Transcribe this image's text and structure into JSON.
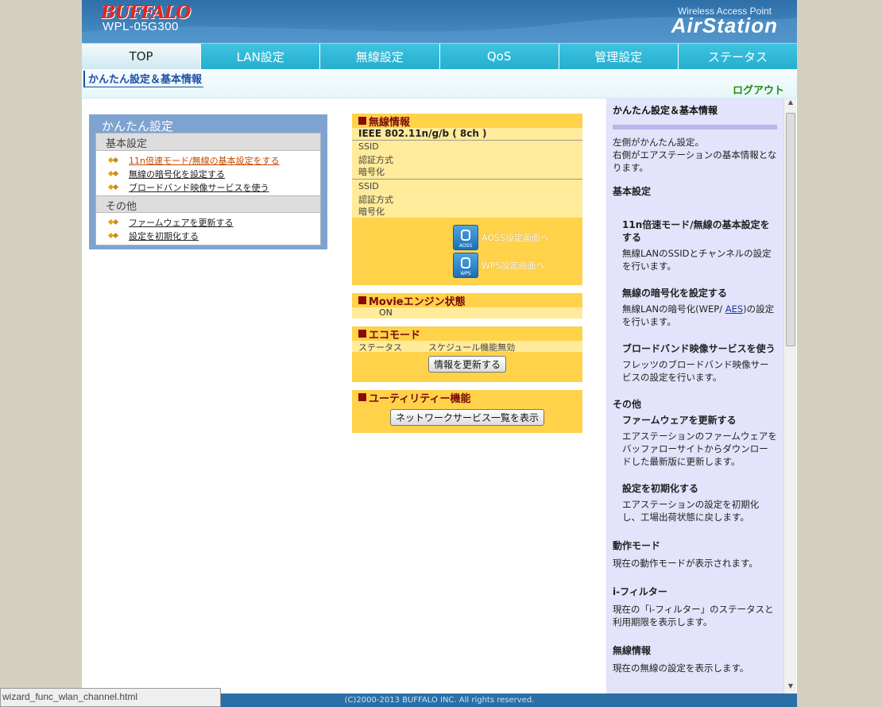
{
  "header": {
    "brand": "BUFFALO",
    "model": "WPL-05G300",
    "product_sub": "Wireless Access Point",
    "product": "AirStation"
  },
  "nav": {
    "tabs": [
      "TOP",
      "LAN設定",
      "無線設定",
      "QoS",
      "管理設定",
      "ステータス"
    ]
  },
  "subbar": {
    "breadcrumb": "かんたん設定＆基本情報",
    "logout": "ログアウト"
  },
  "easy": {
    "title": "かんたん設定",
    "section1": "基本設定",
    "items1": [
      "11n倍速モード/無線の基本設定をする",
      "無線の暗号化を設定する",
      "ブロードバンド映像サービスを使う"
    ],
    "section2": "その他",
    "items2": [
      "ファームウェアを更新する",
      "設定を初期化する"
    ]
  },
  "wireless": {
    "title": "無線情報",
    "standard": "IEEE 802.11n/g/b ( 8ch )",
    "fields": [
      "SSID",
      "認証方式",
      "暗号化"
    ],
    "aoss_label": "AOSS設定画面へ",
    "wps_label": "WPS設定画面へ",
    "aoss_icon_text": "AOSS",
    "wps_icon_text": "WPS"
  },
  "movie": {
    "title": "Movieエンジン状態",
    "value": "ON"
  },
  "eco": {
    "title": "エコモード",
    "status_key": "ステータス",
    "status_val": "スケジュール機能無効",
    "refresh_button": "情報を更新する"
  },
  "utility": {
    "title": "ユーティリティー機能",
    "button": "ネットワークサービス一覧を表示"
  },
  "help": {
    "title": "かんたん設定＆基本情報",
    "intro1": "左側がかんたん設定。",
    "intro2": "右側がエアステーションの基本情報となります。",
    "basic": "基本設定",
    "h1": "11n倍速モード/無線の基本設定をする",
    "p1": "無線LANのSSIDとチャンネルの設定を行います。",
    "h2": "無線の暗号化を設定する",
    "p2a": "無線LANの暗号化(WEP/ ",
    "p2link": "AES",
    "p2b": ")の設定を行います。",
    "h3": "ブロードバンド映像サービスを使う",
    "p3": "フレッツのブロードバンド映像サービスの設定を行います。",
    "other": "その他",
    "h4": "ファームウェアを更新する",
    "p4": "エアステーションのファームウェアをバッファローサイトからダウンロードした最新版に更新します。",
    "h5": "設定を初期化する",
    "p5": "エアステーションの設定を初期化し、工場出荷状態に戻します。",
    "mode": "動作モード",
    "mode_p": "現在の動作モードが表示されます。",
    "ifilter": "i-フィルター",
    "ifilter_p": "現在の「i-フィルター」のステータスと利用期限を表示します。",
    "wlinfo": "無線情報",
    "wlinfo_p": "現在の無線の設定を表示します。"
  },
  "footer": "(C)2000-2013 BUFFALO INC. All rights reserved.",
  "statusbar": "wizard_func_wlan_channel.html"
}
